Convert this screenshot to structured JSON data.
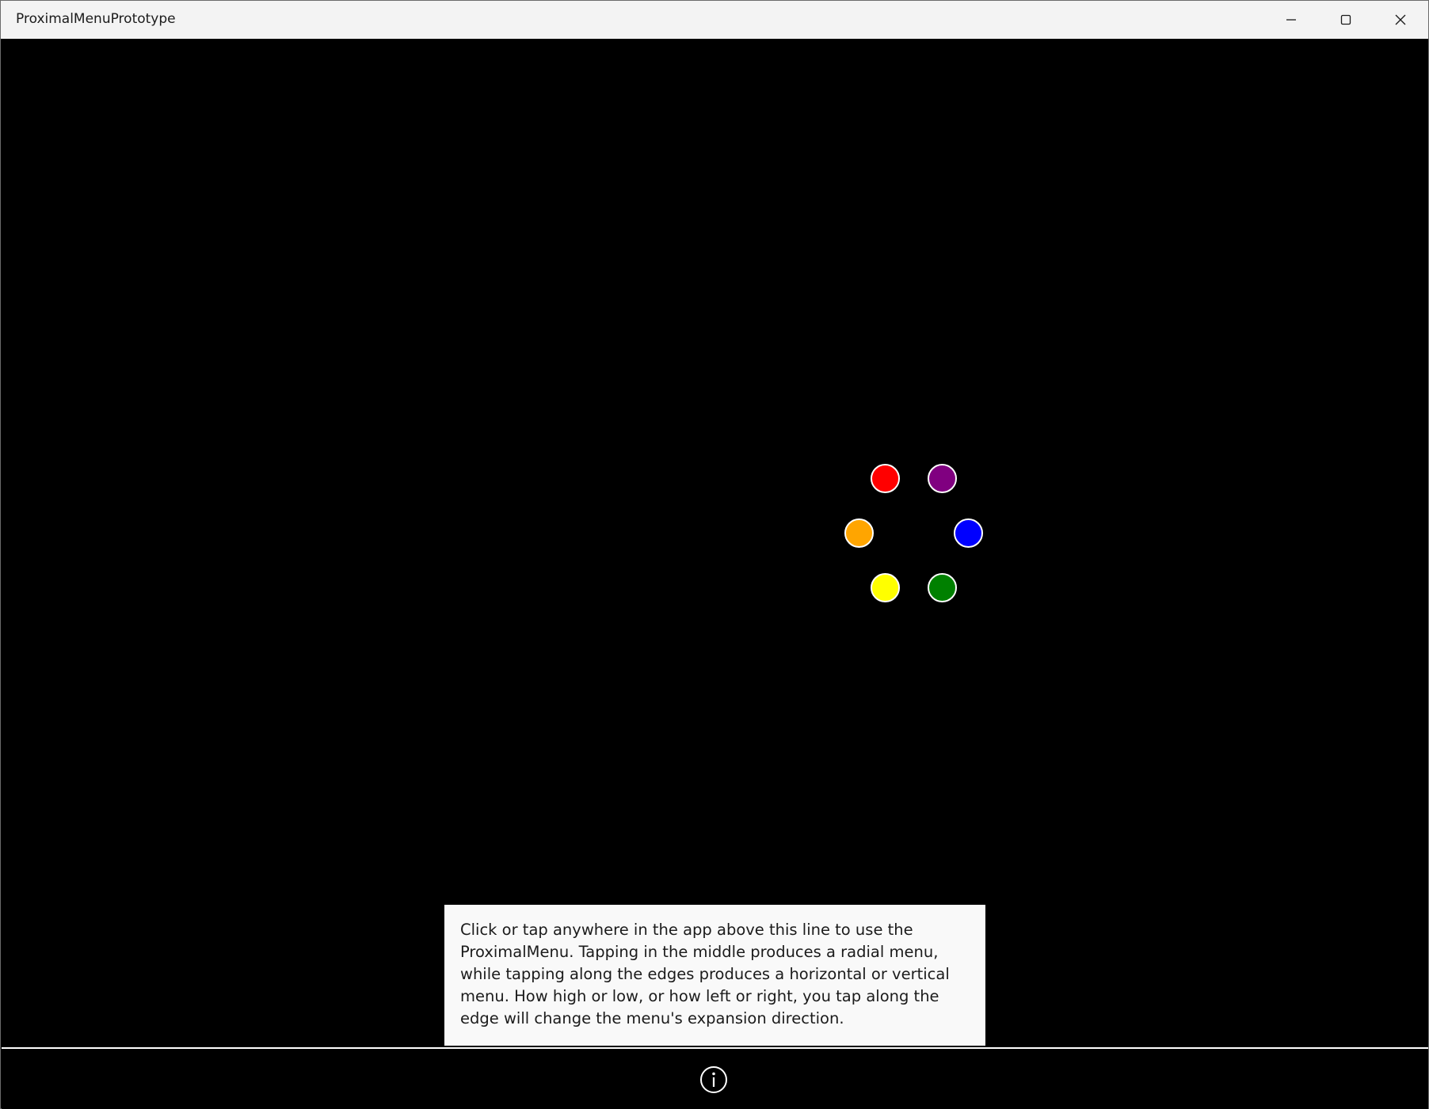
{
  "window": {
    "title": "ProximalMenuPrototype"
  },
  "radial_menu": {
    "items": [
      {
        "color_name": "red",
        "color": "#ff0000"
      },
      {
        "color_name": "purple",
        "color": "#800080"
      },
      {
        "color_name": "orange",
        "color": "#ffa500"
      },
      {
        "color_name": "blue",
        "color": "#0000ff"
      },
      {
        "color_name": "yellow",
        "color": "#ffff00"
      },
      {
        "color_name": "green",
        "color": "#008000"
      }
    ]
  },
  "info_panel": {
    "text": "Click or tap anywhere in the app above this line to use the ProximalMenu.  Tapping in the middle produces a radial menu, while tapping along the edges produces a horizontal or vertical menu. How high or low, or how left or right, you tap along the edge will change the menu's expansion direction."
  },
  "bottom_bar": {
    "info_icon": "info-icon"
  }
}
